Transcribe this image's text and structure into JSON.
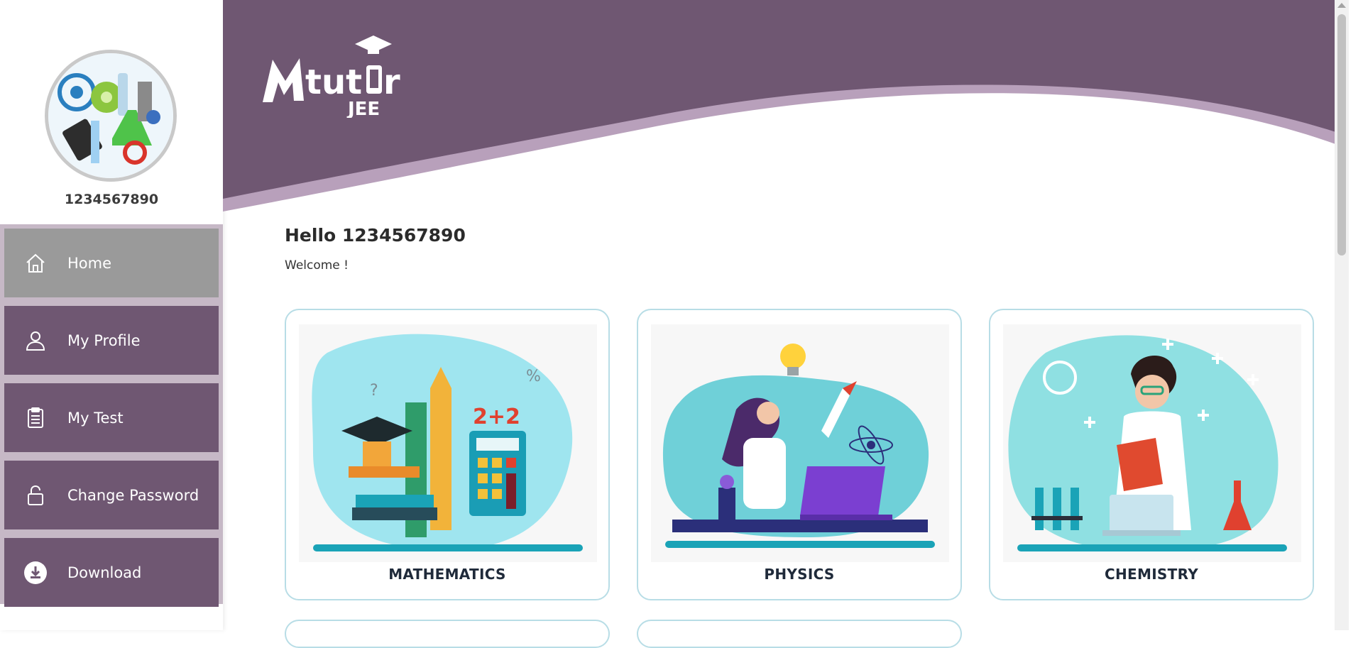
{
  "brand": {
    "logo_text": "Mtutor",
    "logo_sub": "JEE",
    "header_color": "#6f5772",
    "accent_wave": "#b8a0bb"
  },
  "profile": {
    "username": "1234567890"
  },
  "sidebar": {
    "items": [
      {
        "label": "Home",
        "icon": "home-icon",
        "active": true
      },
      {
        "label": "My Profile",
        "icon": "user-icon",
        "active": false
      },
      {
        "label": "My Test",
        "icon": "clipboard-icon",
        "active": false
      },
      {
        "label": "Change Password",
        "icon": "lock-icon",
        "active": false
      },
      {
        "label": "Download",
        "icon": "download-icon",
        "active": false
      }
    ]
  },
  "main": {
    "greeting": "Hello 1234567890",
    "welcome": "Welcome !",
    "subjects": [
      {
        "title": "MATHEMATICS"
      },
      {
        "title": "PHYSICS"
      },
      {
        "title": "CHEMISTRY"
      }
    ]
  }
}
